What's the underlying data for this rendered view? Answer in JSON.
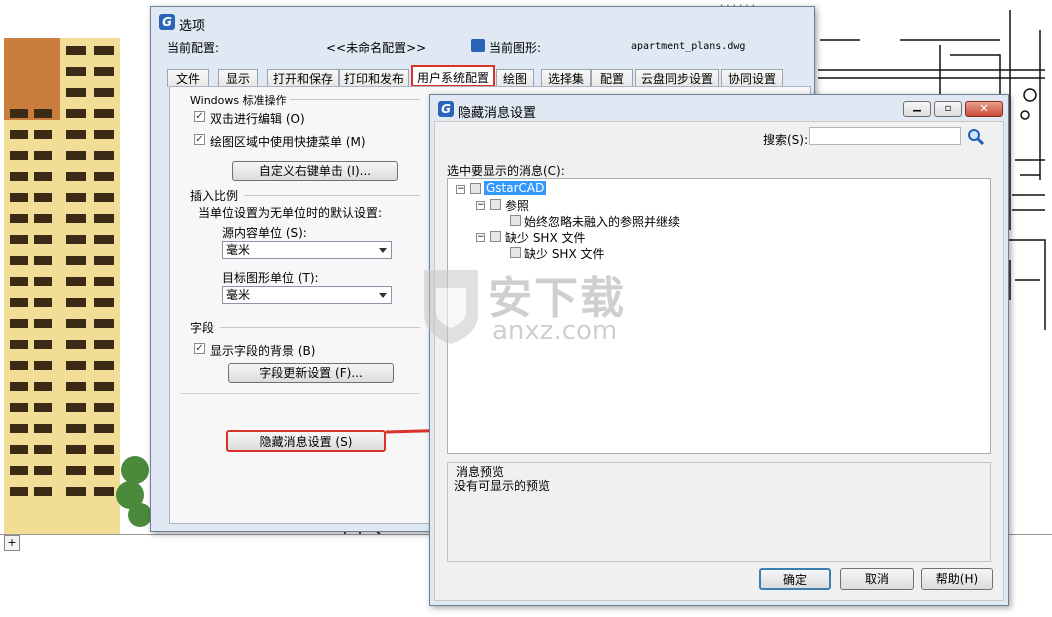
{
  "options_dialog": {
    "title": "选项",
    "current_profile_label": "当前配置:",
    "current_profile_value": "<<未命名配置>>",
    "current_drawing_label": "当前图形:",
    "current_drawing_value": "apartment_plans.dwg",
    "tabs": [
      "文件",
      "显示",
      "打开和保存",
      "打印和发布",
      "用户系统配置",
      "绘图",
      "选择集",
      "配置",
      "云盘同步设置",
      "协同设置"
    ],
    "active_tab": "用户系统配置",
    "windows_ops": {
      "heading": "Windows 标准操作",
      "dblclick_edit": "双击进行编辑 (O)",
      "shortcut_menu": "绘图区域中使用快捷菜单 (M)",
      "right_click_btn": "自定义右键单击 (I)..."
    },
    "insert_scale": {
      "heading": "插入比例",
      "desc": "当单位设置为无单位时的默认设置:",
      "source_label": "源内容单位 (S):",
      "source_value": "毫米",
      "target_label": "目标图形单位 (T):",
      "target_value": "毫米"
    },
    "fields": {
      "heading": "字段",
      "show_bg": "显示字段的背景 (B)",
      "update_btn": "字段更新设置 (F)..."
    },
    "hide_msg_btn": "隐藏消息设置 (S)"
  },
  "hide_dialog": {
    "title": "隐藏消息设置",
    "search_label": "搜索(S):",
    "search_value": "",
    "list_label": "选中要显示的消息(C):",
    "tree": {
      "root": "GstarCAD",
      "ref": "参照",
      "ref_child": "始终忽略未融入的参照并继续",
      "shx": "缺少 SHX 文件",
      "shx_child": "缺少 SHX 文件"
    },
    "preview_label": "消息预览",
    "preview_text": "没有可显示的预览",
    "ok": "确定",
    "cancel": "取消",
    "help": "帮助(H)"
  },
  "watermark": {
    "cn": "安下载",
    "en": "anxz.com"
  },
  "colors": {
    "highlight_red": "#d9322b",
    "tree_select": "#3399ff",
    "building_dark": "#b8743a",
    "building_light": "#f2dd96"
  },
  "icons": [
    "gstarcad-app-icon",
    "drawing-file-icon",
    "search-icon",
    "minimize-icon",
    "maximize-icon",
    "close-icon",
    "arrow-right-icon",
    "shield-icon"
  ]
}
